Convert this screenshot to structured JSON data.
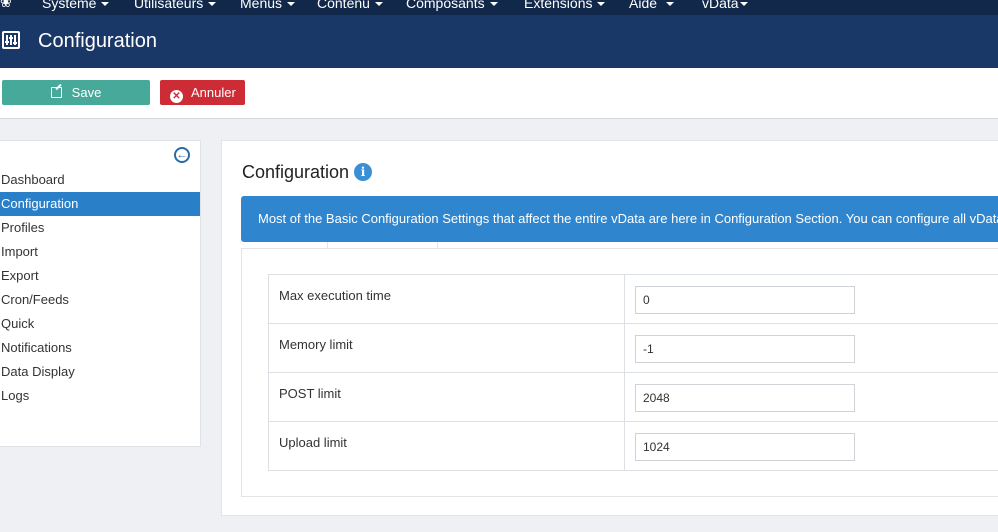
{
  "topbar": {
    "menu": [
      {
        "label": "Système"
      },
      {
        "label": "Utilisateurs"
      },
      {
        "label": "Menus"
      },
      {
        "label": "Contenu"
      },
      {
        "label": "Composants"
      },
      {
        "label": "Extensions"
      },
      {
        "label": "Aide"
      },
      {
        "label": "vData"
      }
    ]
  },
  "header": {
    "title": "Configuration",
    "icon": "sliders-icon"
  },
  "toolbar": {
    "save_label": "Save",
    "cancel_label": "Annuler",
    "save_color": "#46a999",
    "cancel_color": "#cd2b35"
  },
  "sidebar": {
    "items": [
      {
        "label": "Dashboard"
      },
      {
        "label": "Configuration",
        "active": true
      },
      {
        "label": "Profiles"
      },
      {
        "label": "Import"
      },
      {
        "label": "Export"
      },
      {
        "label": "Cron/Feeds"
      },
      {
        "label": "Quick"
      },
      {
        "label": "Notifications"
      },
      {
        "label": "Data Display"
      },
      {
        "label": "Logs"
      }
    ]
  },
  "main": {
    "title": "Configuration",
    "alert": "Most of the Basic Configuration Settings that affect the entire vData are here in Configuration Section. You can configure all vData",
    "rows": [
      {
        "label": "Max execution time",
        "value": "0"
      },
      {
        "label": "Memory limit",
        "value": "-1"
      },
      {
        "label": "POST limit",
        "value": "2048"
      },
      {
        "label": "Upload limit",
        "value": "1024"
      }
    ]
  }
}
